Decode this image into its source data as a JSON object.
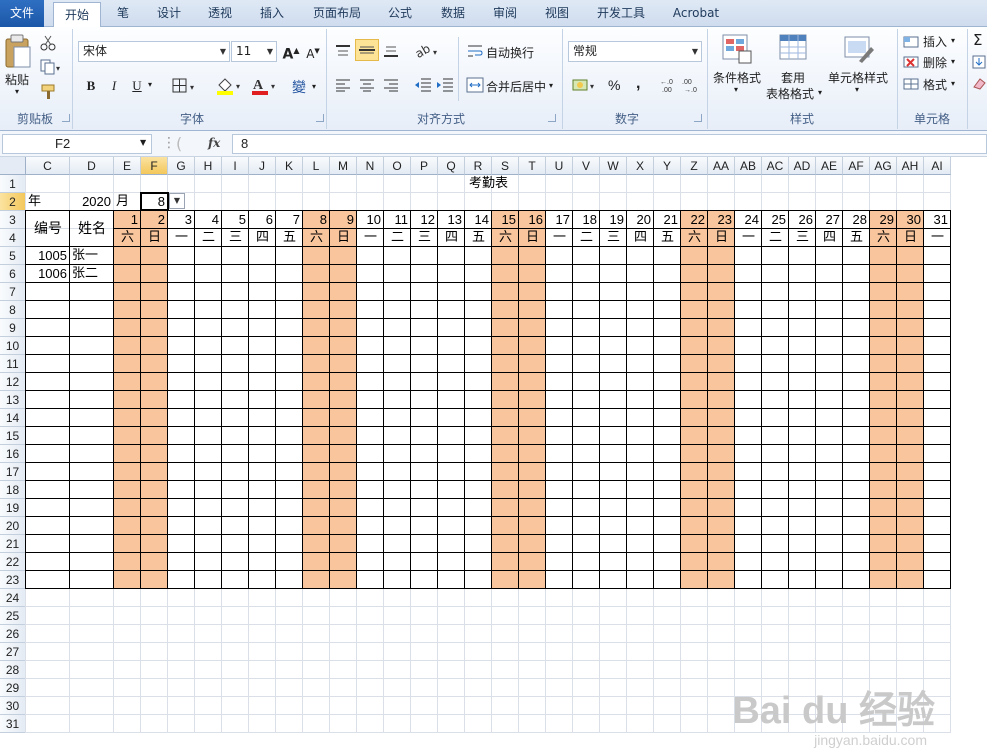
{
  "tabs": [
    "文件",
    "开始",
    "笔",
    "设计",
    "透视",
    "插入",
    "页面布局",
    "公式",
    "数据",
    "审阅",
    "视图",
    "开发工具",
    "Acrobat"
  ],
  "active_tab": "开始",
  "ribbon": {
    "clipboard": {
      "label": "剪贴板",
      "paste": "粘贴"
    },
    "font": {
      "label": "字体",
      "name": "宋体",
      "size": "11",
      "bold": "B",
      "italic": "I",
      "underline": "U",
      "grow": "A",
      "shrink": "A",
      "phonetic": "變"
    },
    "alignment": {
      "label": "对齐方式",
      "wrap": "自动换行",
      "merge": "合并后居中"
    },
    "number": {
      "label": "数字",
      "format": "常规",
      "percent": "%",
      "comma": ","
    },
    "styles": {
      "label": "样式",
      "conditional": "条件格式",
      "table_line1": "套用",
      "table_line2": "表格格式",
      "cell_styles": "单元格样式"
    },
    "cells": {
      "label": "单元格",
      "insert": "插入",
      "delete": "删除",
      "format": "格式"
    },
    "editing": {
      "sigma": "Σ"
    }
  },
  "formula_bar": {
    "name_box": "F2",
    "fx": "fx",
    "value": "8"
  },
  "columns": [
    "C",
    "D",
    "E",
    "F",
    "G",
    "H",
    "I",
    "J",
    "K",
    "L",
    "M",
    "N",
    "O",
    "P",
    "Q",
    "R",
    "S",
    "T",
    "U",
    "V",
    "W",
    "X",
    "Y",
    "Z",
    "AA",
    "AB",
    "AC",
    "AD",
    "AE",
    "AF",
    "AG",
    "AH",
    "AI"
  ],
  "selected_column": "F",
  "rows": [
    "1",
    "2",
    "3",
    "4",
    "5",
    "6",
    "7",
    "8",
    "9",
    "10",
    "11",
    "12",
    "13",
    "14",
    "15",
    "16",
    "17",
    "18",
    "19",
    "20",
    "21",
    "22",
    "23",
    "24",
    "25",
    "26",
    "27",
    "28",
    "29",
    "30",
    "31"
  ],
  "selected_row": "2",
  "sheet": {
    "title": "考勤表",
    "year_label": "年",
    "year": "2020",
    "month_label": "月",
    "month": "8",
    "id_header": "编号",
    "name_header": "姓名",
    "days": [
      "1",
      "2",
      "3",
      "4",
      "5",
      "6",
      "7",
      "8",
      "9",
      "10",
      "11",
      "12",
      "13",
      "14",
      "15",
      "16",
      "17",
      "18",
      "19",
      "20",
      "21",
      "22",
      "23",
      "24",
      "25",
      "26",
      "27",
      "28",
      "29",
      "30",
      "31"
    ],
    "weekdays": [
      "六",
      "日",
      "一",
      "二",
      "三",
      "四",
      "五",
      "六",
      "日",
      "一",
      "二",
      "三",
      "四",
      "五",
      "六",
      "日",
      "一",
      "二",
      "三",
      "四",
      "五",
      "六",
      "日",
      "一",
      "二",
      "三",
      "四",
      "五",
      "六",
      "日",
      "一"
    ],
    "employees": [
      {
        "id": "1005",
        "name": "张一"
      },
      {
        "id": "1006",
        "name": "张二"
      }
    ]
  },
  "watermark": {
    "main": "Bai du 经验",
    "sub": "jingyan.baidu.com"
  },
  "colors": {
    "weekend_fill": "#f8c59c",
    "selection_header": "#f3c75b",
    "tab_file": "#1b57a8"
  }
}
